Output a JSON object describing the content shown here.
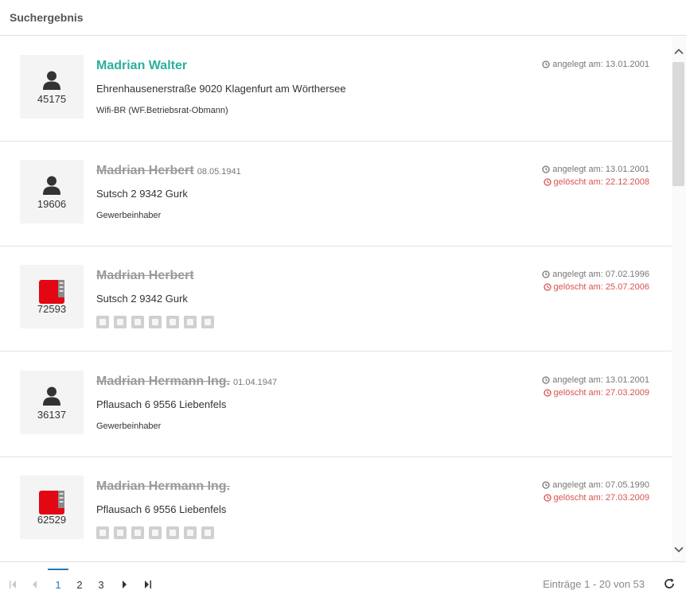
{
  "header": {
    "title": "Suchergebnis"
  },
  "results": [
    {
      "type": "person",
      "id": "45175",
      "name": "Madrian Walter",
      "birth": "",
      "address": "Ehrenhausenerstraße 9020 Klagenfurt am Wörthersee",
      "role": "Wifi-BR (WF.Betriebsrat-Obmann)",
      "deleted": false,
      "created": "angelegt am: 13.01.2001",
      "deleted_at": ""
    },
    {
      "type": "person",
      "id": "19606",
      "name": "Madrian Herbert",
      "birth": "08.05.1941",
      "address": "Sutsch 2 9342 Gurk",
      "role": "Gewerbeinhaber",
      "deleted": true,
      "created": "angelegt am: 13.01.2001",
      "deleted_at": "gelöscht am: 22.12.2008"
    },
    {
      "type": "company",
      "id": "72593",
      "name": "Madrian Herbert",
      "birth": "",
      "address": "Sutsch 2 9342 Gurk",
      "role": "",
      "deleted": true,
      "created": "angelegt am: 07.02.1996",
      "deleted_at": "gelöscht am: 25.07.2006"
    },
    {
      "type": "person",
      "id": "36137",
      "name": "Madrian Hermann Ing.",
      "birth": "01.04.1947",
      "address": "Pflausach 6 9556 Liebenfels",
      "role": "Gewerbeinhaber",
      "deleted": true,
      "created": "angelegt am: 13.01.2001",
      "deleted_at": "gelöscht am: 27.03.2009"
    },
    {
      "type": "company",
      "id": "62529",
      "name": "Madrian Hermann Ing.",
      "birth": "",
      "address": "Pflausach 6 9556 Liebenfels",
      "role": "",
      "deleted": true,
      "created": "angelegt am: 07.05.1990",
      "deleted_at": "gelöscht am: 27.03.2009"
    }
  ],
  "icons": {
    "person": "user-icon",
    "company": "wko-logo",
    "clock": "clock-icon",
    "symbols": [
      "chart-icon",
      "globe-icon",
      "building-icon",
      "document-icon",
      "edit-icon",
      "folder-icon",
      "external-link-icon"
    ]
  },
  "pagination": {
    "pages": [
      "1",
      "2",
      "3"
    ],
    "current_page": "1",
    "entries": "Einträge 1 - 20 von 53"
  },
  "colors": {
    "active_name": "#2ab09a",
    "deleted_name": "#9a9a9a",
    "deleted_date": "#d9534f",
    "pager_accent": "#1f7ab8",
    "wko_red": "#e30613"
  }
}
